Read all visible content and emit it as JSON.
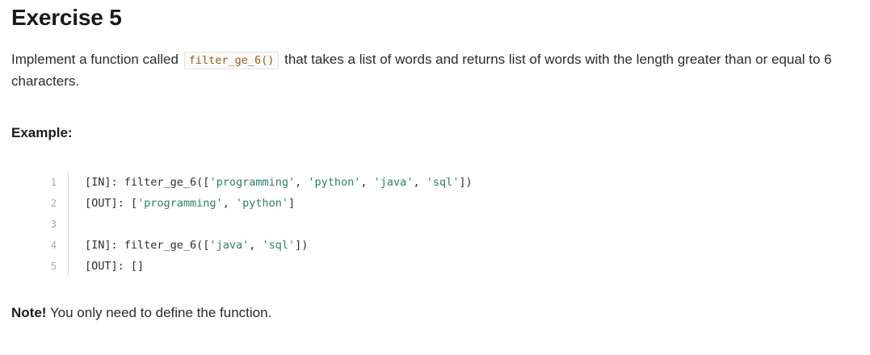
{
  "title": "Exercise 5",
  "description": {
    "before": "Implement a function called",
    "code": "filter_ge_6()",
    "after": "that takes a list of words and returns list of words with the length greater than or equal to 6 characters."
  },
  "example_heading": "Example:",
  "code_lines": [
    {
      "number": "1",
      "parts": [
        {
          "text": "[IN]: filter_ge_6([",
          "kind": "plain"
        },
        {
          "text": "'programming'",
          "kind": "string"
        },
        {
          "text": ", ",
          "kind": "plain"
        },
        {
          "text": "'python'",
          "kind": "string"
        },
        {
          "text": ", ",
          "kind": "plain"
        },
        {
          "text": "'java'",
          "kind": "string"
        },
        {
          "text": ", ",
          "kind": "plain"
        },
        {
          "text": "'sql'",
          "kind": "string"
        },
        {
          "text": "])",
          "kind": "plain"
        }
      ]
    },
    {
      "number": "2",
      "parts": [
        {
          "text": "[OUT]: [",
          "kind": "plain"
        },
        {
          "text": "'programming'",
          "kind": "string"
        },
        {
          "text": ", ",
          "kind": "plain"
        },
        {
          "text": "'python'",
          "kind": "string"
        },
        {
          "text": "]",
          "kind": "plain"
        }
      ]
    },
    {
      "number": "3",
      "parts": []
    },
    {
      "number": "4",
      "parts": [
        {
          "text": "[IN]: filter_ge_6([",
          "kind": "plain"
        },
        {
          "text": "'java'",
          "kind": "string"
        },
        {
          "text": ", ",
          "kind": "plain"
        },
        {
          "text": "'sql'",
          "kind": "string"
        },
        {
          "text": "])",
          "kind": "plain"
        }
      ]
    },
    {
      "number": "5",
      "parts": [
        {
          "text": "[OUT]: []",
          "kind": "plain"
        }
      ]
    }
  ],
  "note": {
    "label": "Note!",
    "text": "You only need to define the function."
  },
  "colors": {
    "inline_code": "#9c5f1d",
    "string": "#2f7d6d",
    "line_number": "#a8a8a8"
  }
}
